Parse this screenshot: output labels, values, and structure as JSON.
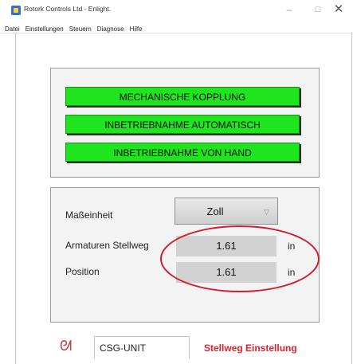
{
  "window": {
    "title": "Rotork Controls Ltd - Enlight.",
    "minimize": "–",
    "maximize": "☐",
    "close": "✕"
  },
  "menu": [
    "Datei",
    "Einstellungen",
    "Steuern",
    "Diagnose",
    "Hilfe"
  ],
  "buttons": {
    "mech": "MECHANISCHE KOPPLUNG",
    "auto": "INBETRIEBNAHME AUTOMATISCH",
    "manual": "INBETRIEBNAHME VON HAND"
  },
  "settings": {
    "unit_label": "Maßeinheit",
    "unit_value": "Zoll",
    "stroke_label": "Armaturen Stellweg",
    "stroke_value": "1.61",
    "stroke_unit": "in",
    "position_label": "Position",
    "position_value": "1.61",
    "position_unit": "in"
  },
  "footer": {
    "device": "CSG-UNIT",
    "mode": "Stellweg Einstellung"
  },
  "colors": {
    "green_button": "#1ee51e",
    "highlight_ellipse": "#d21f2f",
    "mode_text": "#e0202e"
  }
}
